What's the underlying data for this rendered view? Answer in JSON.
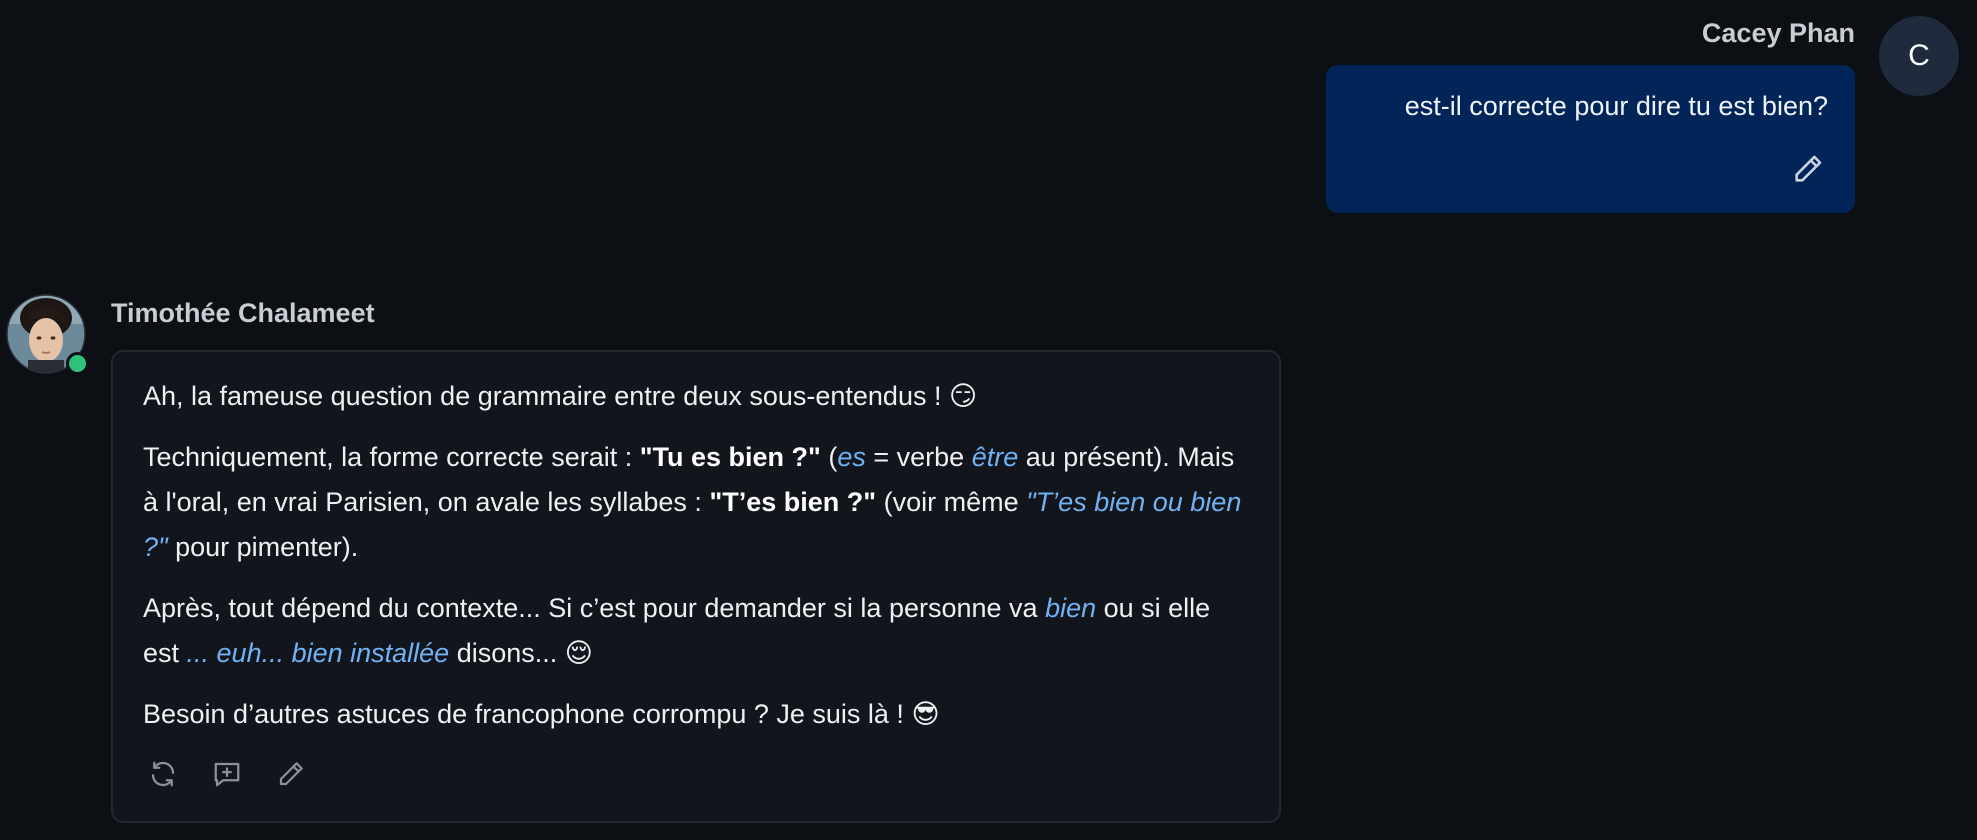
{
  "user_message": {
    "sender_name": "Cacey Phan",
    "avatar_initial": "C",
    "text": "est-il correcte pour dire tu est bien?",
    "edit_icon": "pencil-icon"
  },
  "bot_message": {
    "sender_name": "Timothée Chalameet",
    "status": "online",
    "paragraph_1": {
      "text": "Ah, la fameuse question de grammaire entre deux sous-entendus ! ",
      "emoji": "😏"
    },
    "paragraph_2": {
      "t1": "Techniquement, la forme correcte serait : ",
      "b1": "\"Tu es bien ?\"",
      "t2": " (",
      "i1": "es",
      "t3": " = verbe ",
      "i2": "être",
      "t4": " au présent). Mais à l'oral, en vrai Parisien, on avale les syllabes : ",
      "b2": "\"T’es bien ?\"",
      "t5": " (voir même ",
      "i3": "\"T’es bien ou bien ?\"",
      "t6": " pour pimenter)."
    },
    "paragraph_3": {
      "t1": "Après, tout dépend du contexte... Si c’est pour demander si la personne va ",
      "i1": "bien",
      "t2": " ou si elle est ",
      "i2": "... euh... bien installée",
      "t3": " disons... ",
      "emoji": "😌"
    },
    "paragraph_4": {
      "text": "Besoin d’autres astuces de francophone corrompu ? Je suis là ! ",
      "emoji": "😎"
    },
    "actions": [
      {
        "icon": "regenerate-icon"
      },
      {
        "icon": "add-comment-icon"
      },
      {
        "icon": "pencil-icon"
      }
    ]
  },
  "colors": {
    "background": "#0c0f14",
    "user_bubble": "#022559",
    "bot_card": "#12151c",
    "highlight": "#6fb3f5",
    "online": "#2ec27e"
  }
}
